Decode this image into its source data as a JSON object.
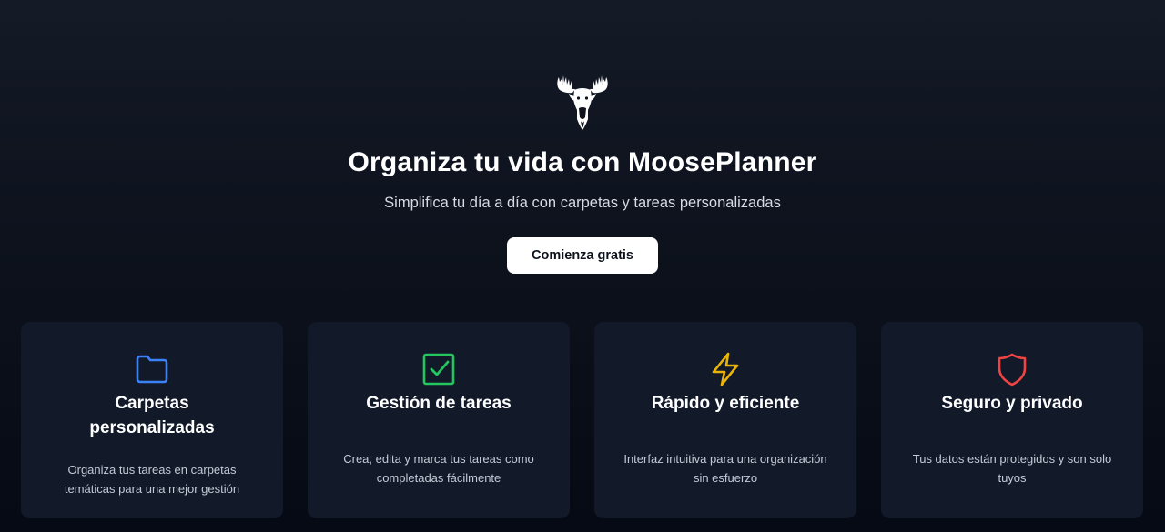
{
  "hero": {
    "logo_icon": "moose-icon",
    "title": "Organiza tu vida con MoosePlanner",
    "subtitle": "Simplifica tu día a día con carpetas y tareas personalizadas",
    "cta_label": "Comienza gratis"
  },
  "features": [
    {
      "icon": "folder-icon",
      "color": "#3b82f6",
      "title": "Carpetas personalizadas",
      "description": "Organiza tus tareas en carpetas temáticas para una mejor gestión"
    },
    {
      "icon": "check-square-icon",
      "color": "#22c55e",
      "title": "Gestión de tareas",
      "description": "Crea, edita y marca tus tareas como completadas fácilmente"
    },
    {
      "icon": "lightning-icon",
      "color": "#eab308",
      "title": "Rápido y eficiente",
      "description": "Interfaz intuitiva para una organización sin esfuerzo"
    },
    {
      "icon": "shield-icon",
      "color": "#ef4444",
      "title": "Seguro y privado",
      "description": "Tus datos están protegidos y son solo tuyos"
    }
  ]
}
